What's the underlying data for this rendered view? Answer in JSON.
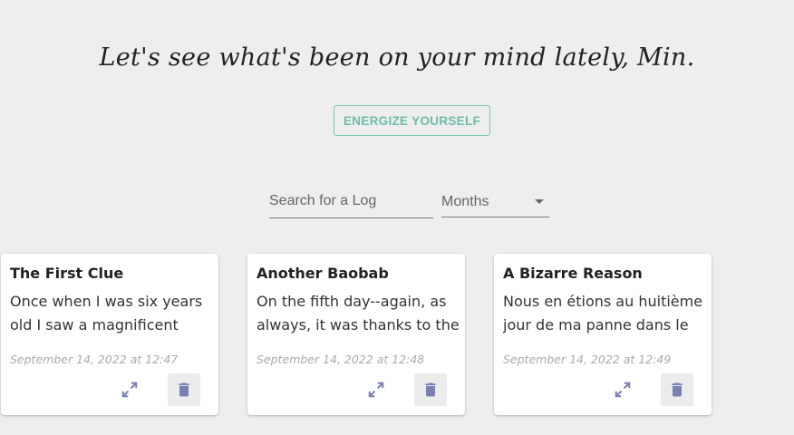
{
  "header": {
    "headline": "Let's see what's been on your mind lately, Min.",
    "energize_label": "ENERGIZE YOURSELF"
  },
  "filters": {
    "search_placeholder": "Search for a Log",
    "months_label": "Months"
  },
  "colors": {
    "accent_teal": "#6dbcaa",
    "icon_purple": "#7b80b3",
    "background": "#eeeeee"
  },
  "logs": [
    {
      "title": "The First Clue",
      "body": "Once when I was six years old I saw a magnificent picture in a book",
      "date": "September 14, 2022 at 12:47",
      "expand_icon": "expand-icon",
      "delete_icon": "trash-icon"
    },
    {
      "title": "Another Baobab",
      "body": "On the fifth day--again, as always, it was thanks to the sheep",
      "date": "September 14, 2022 at 12:48",
      "expand_icon": "expand-icon",
      "delete_icon": "trash-icon"
    },
    {
      "title": "A Bizarre Reason",
      "body": "Nous en étions au huitième jour de ma panne dans le désert",
      "date": "September 14, 2022 at 12:49",
      "expand_icon": "expand-icon",
      "delete_icon": "trash-icon"
    }
  ]
}
